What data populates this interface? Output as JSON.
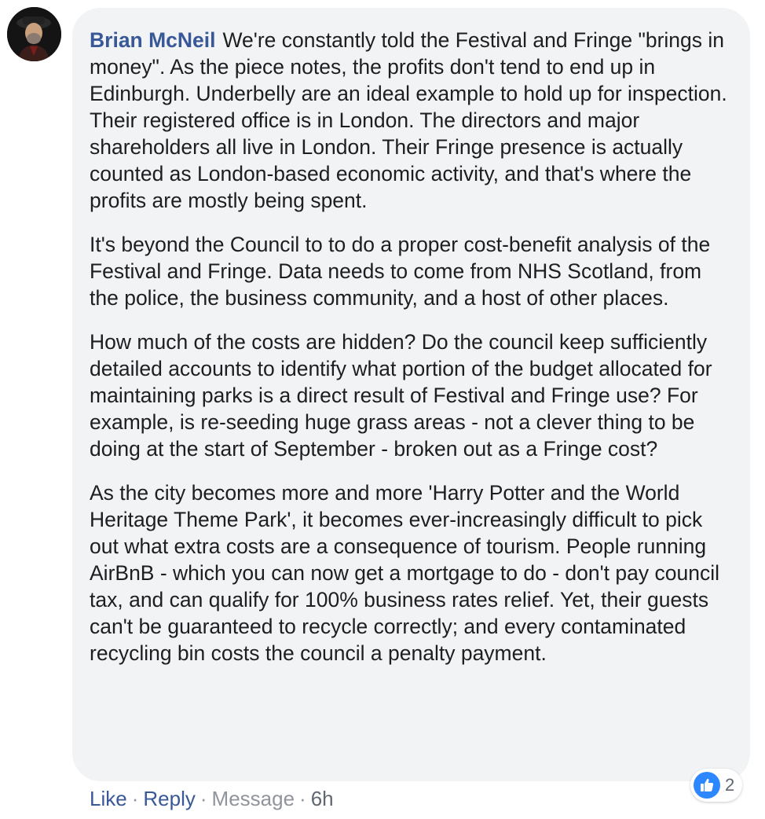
{
  "comment": {
    "author": "Brian McNeil",
    "paragraphs": [
      "We're constantly told the Festival and Fringe \"brings in money\". As the piece notes, the profits don't tend to end up in Edinburgh. Underbelly are an ideal example to hold up for inspection. Their registered office is in London. The directors and major shareholders all live in London. Their Fringe presence is actually counted as London-based economic activity, and that's where the profits are mostly being spent.",
      "It's beyond the Council to to do a proper cost-benefit analysis of the Festival and Fringe. Data needs to come from NHS Scotland, from the police, the business community, and a host of other places.",
      "How much of the costs are hidden? Do the council keep sufficiently detailed accounts to identify what portion of the budget allocated for maintaining parks is a direct result of Festival and Fringe use? For example, is re-seeding huge grass areas - not a clever thing to be doing at the start of September - broken out as a Fringe cost?",
      "As the city becomes more and more 'Harry Potter and the World Heritage Theme Park', it becomes ever-increasingly difficult to pick out what extra costs are a consequence of tourism. People running AirBnB - which you can now get a mortgage to do - don't pay council tax, and can qualify for 100% business rates relief. Yet, their guests can't be guaranteed to recycle correctly; and every contaminated recycling bin costs the council a penalty payment."
    ]
  },
  "actions": {
    "like": "Like",
    "reply": "Reply",
    "message": "Message",
    "time": "6h",
    "separator": "·"
  },
  "reactions": {
    "icon": "like-thumb-icon",
    "count": "2"
  },
  "colors": {
    "link": "#385898",
    "bubble": "#f2f3f5",
    "text": "#1c1e21",
    "like_blue": "#2d88ff"
  }
}
